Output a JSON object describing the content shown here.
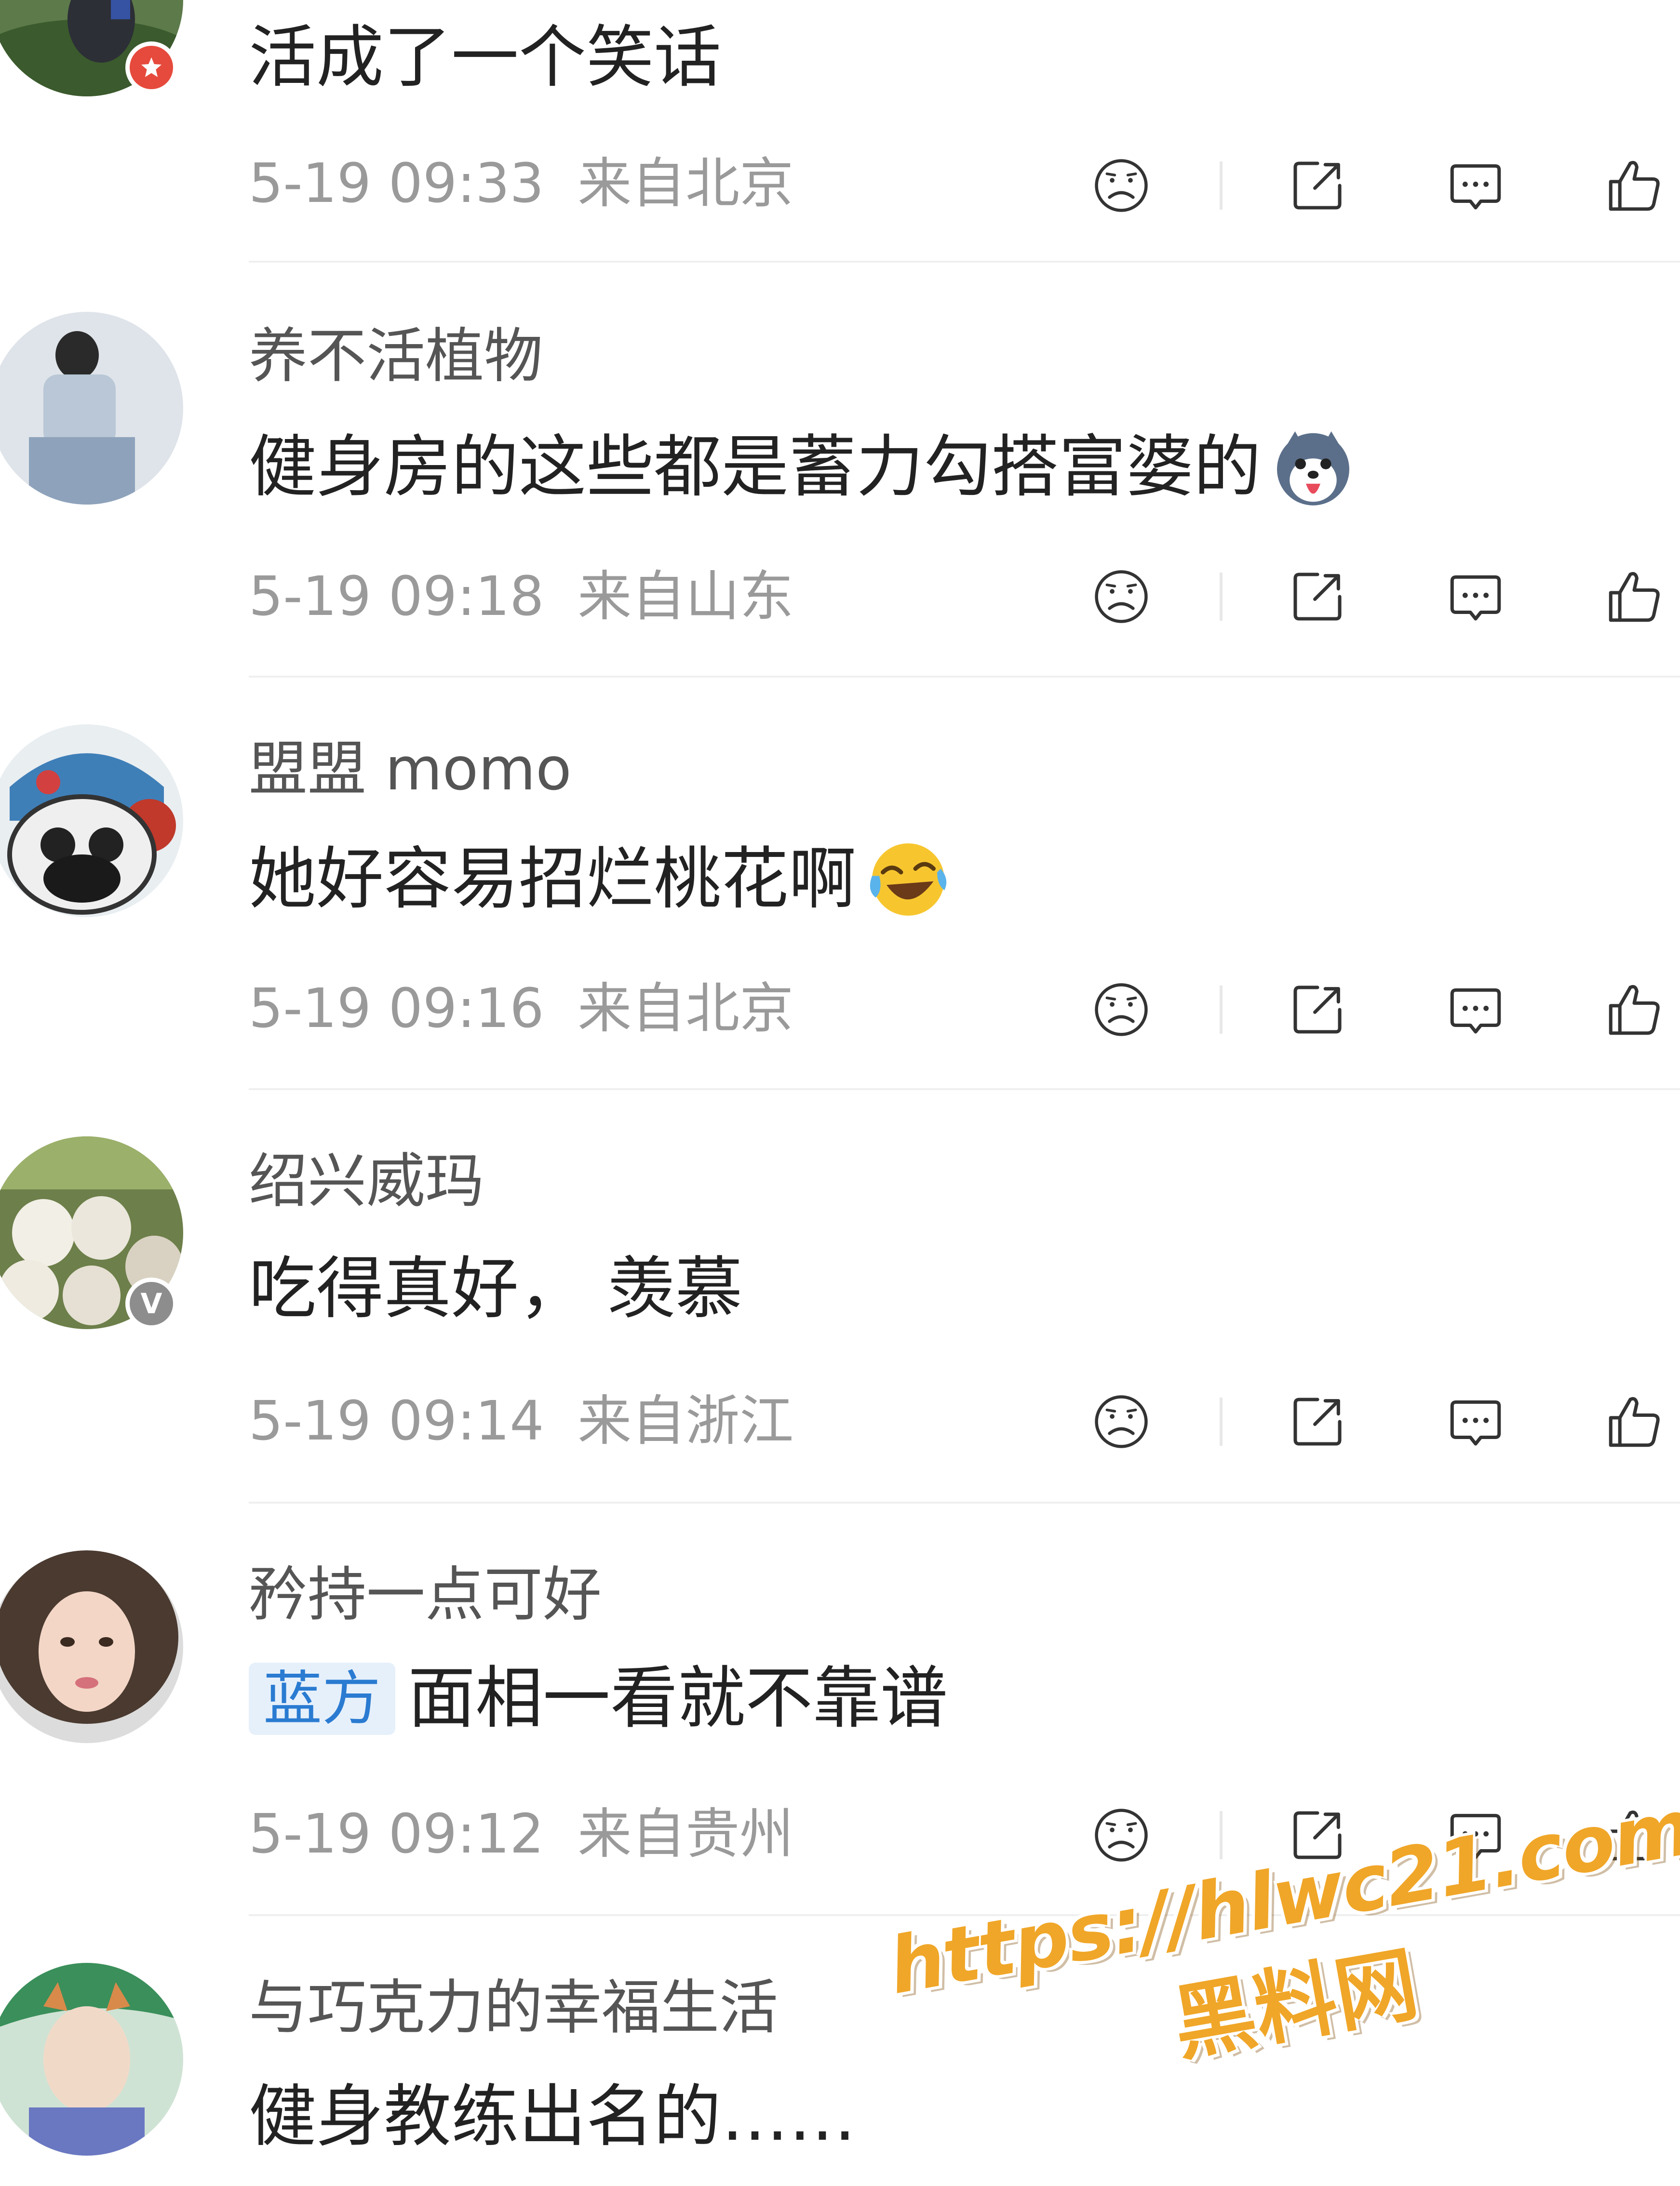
{
  "colors": {
    "tag_bg": "#e6f0fb",
    "tag_text": "#2a7bd1",
    "watermark": "#f0a628",
    "meta": "#9a9a9a"
  },
  "comments": [
    {
      "username": "",
      "text": "活成了一个笑话",
      "time": "5-19 09:33",
      "location": "来自北京",
      "badge": "star-badge-icon"
    },
    {
      "username": "养不活植物",
      "text": "健身房的这些都是蓄力勾搭富婆的",
      "emoji": "husky-dog-emoji",
      "time": "5-19 09:18",
      "location": "来自山东"
    },
    {
      "username": "盟盟 momo",
      "text": "她好容易招烂桃花啊",
      "emoji": "laugh-cry-emoji",
      "time": "5-19 09:16",
      "location": "来自北京"
    },
    {
      "username": "绍兴威玛",
      "text": "吃得真好， 羡慕",
      "badge": "verified-v-icon",
      "badge_text": "V",
      "time": "5-19 09:14",
      "location": "来自浙江"
    },
    {
      "username": "矜持一点可好",
      "tag": "蓝方",
      "text": "面相一看就不靠谱",
      "time": "5-19 09:12",
      "location": "来自贵州"
    },
    {
      "username": "与巧克力的幸福生活",
      "text": "健身教练出名的……"
    }
  ],
  "actions": [
    "dislike-icon",
    "share-icon",
    "comment-icon",
    "like-icon"
  ],
  "watermark": {
    "url": "https://hlwc21.com",
    "name": "黑料网"
  }
}
